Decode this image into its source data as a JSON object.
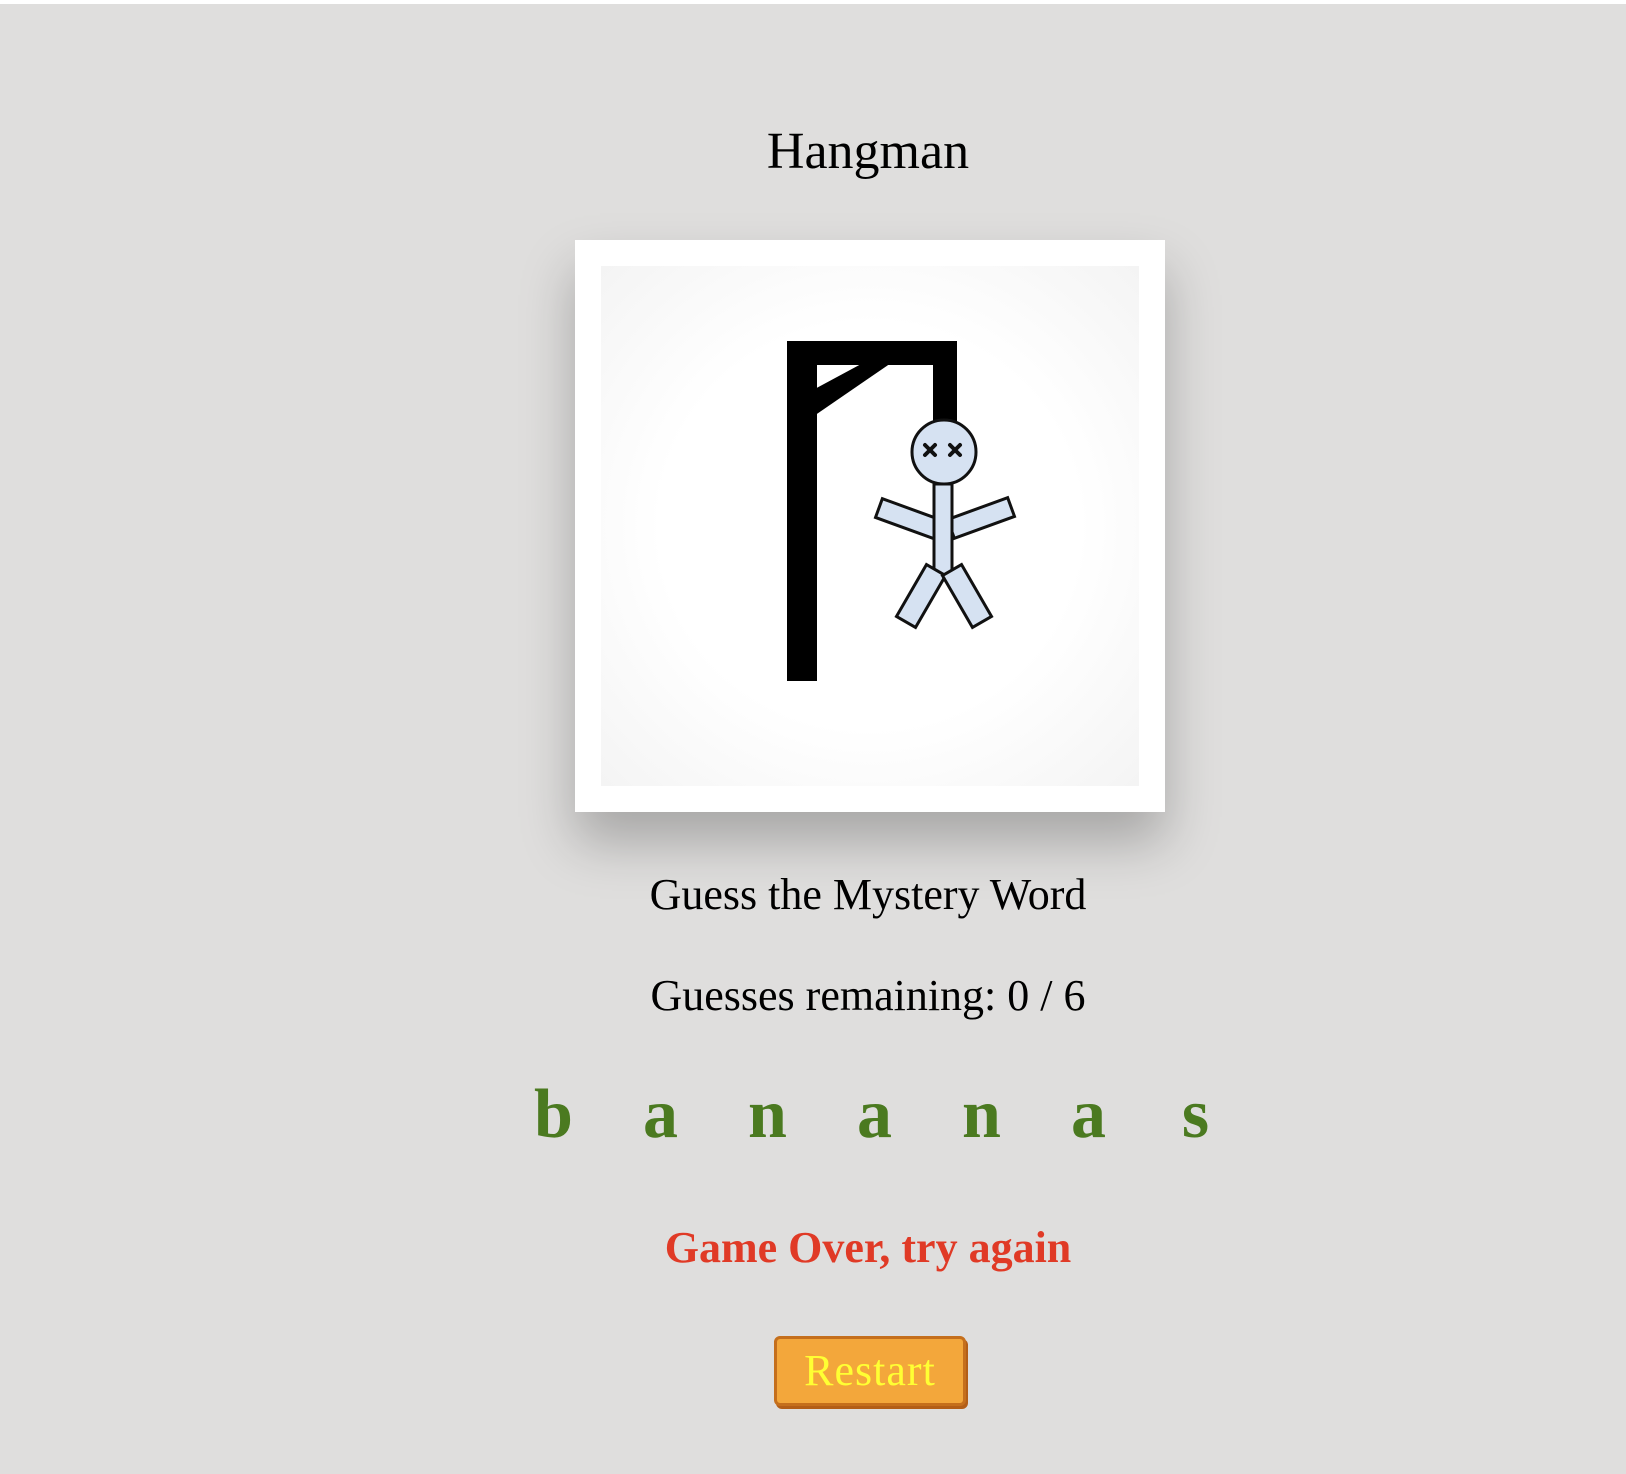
{
  "app": {
    "title": "Hangman"
  },
  "game": {
    "prompt": "Guess the Mystery Word",
    "guesses_label": "Guesses remaining: 0 / 6",
    "word_letters": [
      "b",
      "a",
      "n",
      "a",
      "n",
      "a",
      "s"
    ],
    "status_message": "Game Over, try again",
    "restart_label": "Restart",
    "guesses_remaining": 0,
    "guesses_total": 6
  },
  "colors": {
    "background": "#dfdedd",
    "revealed_letter": "#4b7a20",
    "game_over": "#e03a26",
    "restart_button": "#f3a73b",
    "restart_text": "#ffff33",
    "hangman_body": "#d6e2f2"
  }
}
